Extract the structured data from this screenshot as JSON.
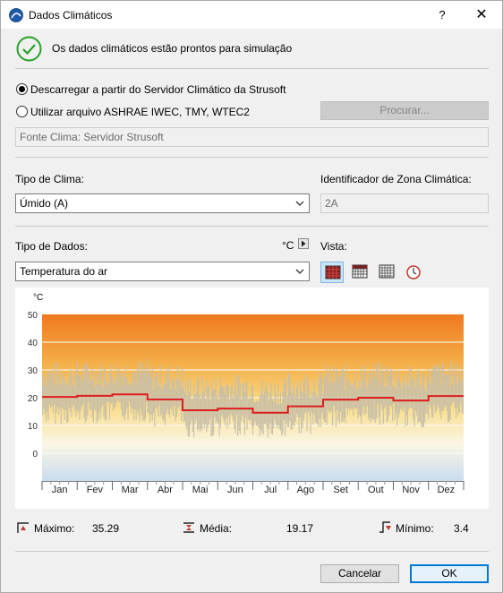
{
  "window": {
    "title": "Dados Climáticos",
    "help": "?",
    "close": "✕"
  },
  "status": {
    "message": "Os dados climáticos estão prontos para simulação",
    "icon": "check-circle-icon",
    "color": "#2aa12a"
  },
  "source": {
    "option_server": "Descarregar a partir do Servidor Climático da Strusoft",
    "option_file": "Utilizar arquivo ASHRAE IWEC, TMY, WTEC2",
    "selected": "server",
    "browse_label": "Procurar...",
    "source_field": "Fonte Clima: Servidor Strusoft"
  },
  "climate": {
    "type_label": "Tipo de Clima:",
    "type_value": "Úmido (A)",
    "zone_label": "Identificador de Zona Climática:",
    "zone_value": "2A"
  },
  "data_type": {
    "label": "Tipo de Dados:",
    "value": "Temperatura do ar",
    "unit": "°C",
    "view_label": "Vista:",
    "views": [
      "monthly-grid-icon",
      "daily-grid-icon",
      "hourly-grid-icon",
      "clock-icon"
    ],
    "selected_view": 0
  },
  "chart_data": {
    "type": "line",
    "unit_label": "°C",
    "y_ticks": [
      50,
      40,
      30,
      20,
      10,
      0
    ],
    "ylim": [
      -10,
      50
    ],
    "categories": [
      "Jan",
      "Fev",
      "Mar",
      "Abr",
      "Mai",
      "Jun",
      "Jul",
      "Ago",
      "Set",
      "Out",
      "Nov",
      "Dez"
    ],
    "monthly_mean": [
      20.3,
      20.7,
      21.2,
      19.4,
      15.5,
      16.1,
      14.6,
      16.9,
      19.3,
      20.0,
      19.0,
      20.6
    ],
    "grid": true,
    "colors": {
      "mean_line": "#dd1e1e",
      "daily_range": "#c8bfa8",
      "gradient_top": "#f07820",
      "gradient_mid": "#f8dc88",
      "gradient_bottom": "#c8dcee"
    }
  },
  "stats": {
    "max_label": "Máximo:",
    "max_value": "35.29",
    "mean_label": "Média:",
    "mean_value": "19.17",
    "min_label": "Mínimo:",
    "min_value": "3.4"
  },
  "footer": {
    "cancel": "Cancelar",
    "ok": "OK"
  }
}
